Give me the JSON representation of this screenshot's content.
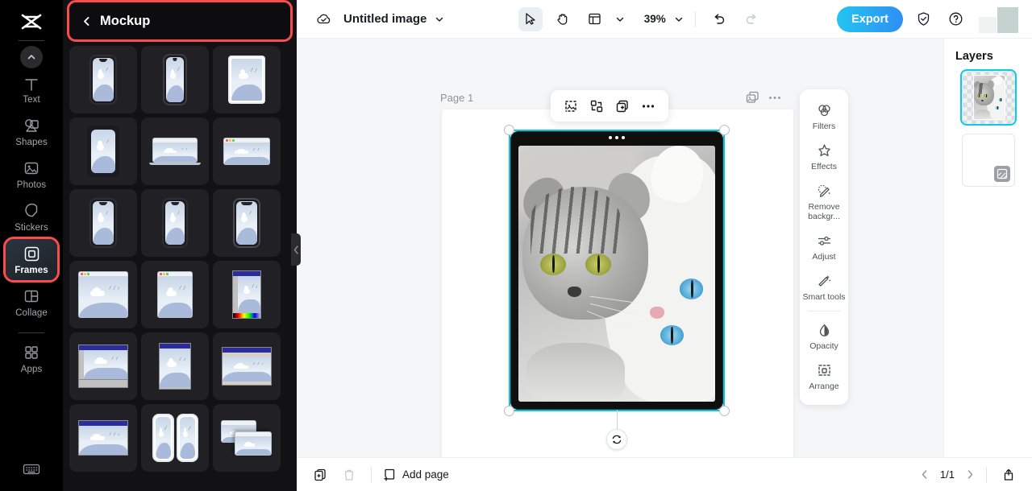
{
  "rail": {
    "logo": "capcut-logo",
    "items": [
      {
        "label": "Text",
        "icon": "text-icon"
      },
      {
        "label": "Shapes",
        "icon": "shapes-icon"
      },
      {
        "label": "Photos",
        "icon": "photos-icon"
      },
      {
        "label": "Stickers",
        "icon": "stickers-icon"
      },
      {
        "label": "Frames",
        "icon": "frames-icon"
      },
      {
        "label": "Collage",
        "icon": "collage-icon"
      },
      {
        "label": "Apps",
        "icon": "apps-icon"
      }
    ],
    "bottom_icon": "keyboard-icon"
  },
  "panel": {
    "title": "Mockup",
    "back_icon": "chevron-left-icon",
    "collapse_icon": "chevron-left-icon",
    "tiles": [
      {
        "kind": "phone-notch",
        "name": "phone-mockup-1"
      },
      {
        "kind": "phone-notch",
        "name": "phone-mockup-2"
      },
      {
        "kind": "tablet",
        "name": "tablet-mockup-1"
      },
      {
        "kind": "phone-plain",
        "name": "phone-mockup-3"
      },
      {
        "kind": "laptop",
        "name": "laptop-mockup-1"
      },
      {
        "kind": "browser",
        "name": "browser-mockup-1"
      },
      {
        "kind": "phone-notch",
        "name": "phone-mockup-4"
      },
      {
        "kind": "phone-notch",
        "name": "phone-mockup-5"
      },
      {
        "kind": "phone-notch",
        "name": "phone-mockup-6"
      },
      {
        "kind": "browser-wide",
        "name": "browser-mockup-2"
      },
      {
        "kind": "browser-tall",
        "name": "browser-mockup-3"
      },
      {
        "kind": "retro-paint",
        "name": "retro-window-mockup-1"
      },
      {
        "kind": "retro-paint",
        "name": "retro-window-mockup-2"
      },
      {
        "kind": "retro-tall",
        "name": "retro-window-mockup-3"
      },
      {
        "kind": "retro-wide",
        "name": "retro-window-mockup-4"
      },
      {
        "kind": "retro-wide",
        "name": "retro-window-mockup-5"
      },
      {
        "kind": "two-phones",
        "name": "dual-phone-mockup"
      },
      {
        "kind": "stacked-windows",
        "name": "stacked-window-mockup"
      }
    ]
  },
  "topbar": {
    "cloud_icon": "cloud-saved-icon",
    "doc_name": "Untitled image",
    "doc_caret": "chevron-down-icon",
    "select_tool": "cursor-icon",
    "hand_tool": "hand-icon",
    "layout_tool": "layout-icon",
    "layout_caret": "chevron-down-icon",
    "zoom_level": "39%",
    "zoom_caret": "chevron-down-icon",
    "undo_icon": "undo-icon",
    "redo_icon": "redo-icon",
    "export_label": "Export",
    "shield_icon": "shield-check-icon",
    "help_icon": "help-circle-icon",
    "avatar": "user-avatar"
  },
  "canvas": {
    "page_label": "Page 1",
    "float_toolbar": [
      {
        "name": "crop-icon"
      },
      {
        "name": "replace-image-icon"
      },
      {
        "name": "duplicate-icon"
      },
      {
        "name": "more-options-icon"
      }
    ],
    "extra_icons": [
      {
        "name": "layers-stack-icon"
      },
      {
        "name": "more-options-icon"
      }
    ],
    "rotate_icon": "rotate-icon",
    "selection_color": "#00c8e0",
    "image_alt": "two cats photo"
  },
  "tools": {
    "items": [
      {
        "label": "Filters",
        "icon": "filters-icon"
      },
      {
        "label": "Effects",
        "icon": "effects-icon"
      },
      {
        "label": "Remove backgr...",
        "icon": "remove-background-icon"
      },
      {
        "label": "Adjust",
        "icon": "adjust-icon"
      },
      {
        "label": "Smart tools",
        "icon": "smart-tools-icon"
      },
      {
        "label": "Opacity",
        "icon": "opacity-icon"
      },
      {
        "label": "Arrange",
        "icon": "arrange-icon"
      }
    ]
  },
  "layers": {
    "title": "Layers",
    "items": [
      {
        "name": "layer-image-cats",
        "type": "image",
        "selected": true
      },
      {
        "name": "layer-page-background",
        "type": "blank",
        "selected": false
      }
    ]
  },
  "bottombar": {
    "duplicate_icon": "duplicate-page-icon",
    "delete_icon": "delete-page-icon",
    "add_page_label": "Add page",
    "add_page_icon": "add-page-icon",
    "prev_icon": "chevron-left-icon",
    "page_indicator": "1/1",
    "next_icon": "chevron-right-icon",
    "upload_icon": "upload-icon"
  },
  "colors": {
    "accent": "#00c8e0",
    "export_gradient_start": "#22c6f0",
    "export_gradient_end": "#2f8df5",
    "highlight_red": "#fb4c4c",
    "rail_bg": "#000000",
    "panel_bg": "#121214"
  }
}
